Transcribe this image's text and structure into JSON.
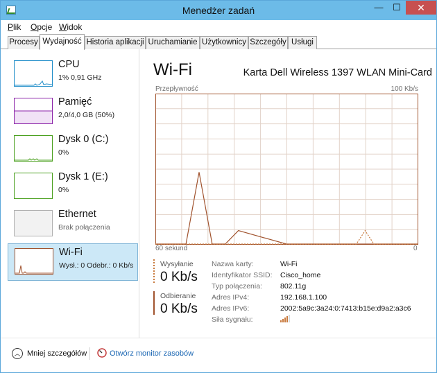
{
  "window": {
    "title": "Menedżer zadań",
    "minimize_glyph": "—",
    "maximize_glyph": "☐",
    "close_glyph": "✕"
  },
  "menu": {
    "items": [
      {
        "label": "Plik",
        "hotkey": "P"
      },
      {
        "label": "Opcje",
        "hotkey": "O"
      },
      {
        "label": "Widok",
        "hotkey": "W"
      }
    ]
  },
  "tabs": [
    {
      "label": "Procesy",
      "active": false
    },
    {
      "label": "Wydajność",
      "active": true
    },
    {
      "label": "Historia aplikacji",
      "active": false
    },
    {
      "label": "Uruchamianie",
      "active": false
    },
    {
      "label": "Użytkownicy",
      "active": false
    },
    {
      "label": "Szczegóły",
      "active": false
    },
    {
      "label": "Usługi",
      "active": false
    }
  ],
  "sidebar": {
    "items": [
      {
        "name": "CPU",
        "sub": "1% 0,91 GHz",
        "color": "#1e8cc8",
        "selected": false
      },
      {
        "name": "Pamięć",
        "sub": "2,0/4,0 GB (50%)",
        "color": "#8b23a8",
        "selected": false
      },
      {
        "name": "Dysk 0 (C:)",
        "sub": "0%",
        "color": "#4aa01e",
        "selected": false
      },
      {
        "name": "Dysk 1 (E:)",
        "sub": "0%",
        "color": "#4aa01e",
        "selected": false
      },
      {
        "name": "Ethernet",
        "sub": "Brak połączenia",
        "color": "#b0b0b0",
        "selected": false
      },
      {
        "name": "Wi-Fi",
        "sub": "Wysł.: 0 Odebr.: 0 Kb/s",
        "color": "#a0522d",
        "selected": true
      }
    ]
  },
  "main": {
    "heading": "Wi-Fi",
    "device_name": "Karta Dell Wireless 1397 WLAN Mini-Card",
    "graph": {
      "top_left_label": "Przepływność",
      "top_right_label": "100 Kb/s",
      "bottom_left_label": "60 sekund",
      "bottom_right_label": "0",
      "line_color": "#a0522d",
      "grid_color": "#e2d2c8"
    },
    "send": {
      "label": "Wysyłanie",
      "value": "0 Kb/s",
      "color": "#c8793c"
    },
    "receive": {
      "label": "Odbieranie",
      "value": "0 Kb/s",
      "color": "#a0522d"
    },
    "properties": [
      {
        "label": "Nazwa karty:",
        "value": "Wi-Fi"
      },
      {
        "label": "Identyfikator SSID:",
        "value": "Cisco_home"
      },
      {
        "label": "Typ połączenia:",
        "value": "802.11g"
      },
      {
        "label": "Adres IPv4:",
        "value": "192.168.1.100"
      },
      {
        "label": "Adres IPv6:",
        "value": "2002:5a9c:3a24:0:7413:b15e:d9a2:a3c6"
      },
      {
        "label": "Siła sygnału:",
        "value": ""
      }
    ],
    "signal_bars_active": 4
  },
  "chart_data": {
    "type": "line",
    "title": "Przepływność",
    "xlabel": "60 sekund",
    "ylabel": "",
    "xlim": [
      60,
      0
    ],
    "ylim": [
      0,
      100
    ],
    "y_unit": "Kb/s",
    "grid": true,
    "series": [
      {
        "name": "Odbieranie",
        "x": [
          60,
          56,
          53,
          50,
          47,
          44,
          41,
          30,
          21,
          18,
          0
        ],
        "y": [
          0,
          0,
          0,
          48,
          0,
          0,
          9,
          0,
          0,
          0,
          0
        ]
      },
      {
        "name": "Wysyłanie",
        "x": [
          60,
          14,
          12,
          10,
          0
        ],
        "y": [
          0,
          0,
          9,
          0,
          0
        ]
      }
    ]
  },
  "footer": {
    "fewer_details": "Mniej szczegółów",
    "open_monitor": "Otwórz monitor zasobów"
  }
}
